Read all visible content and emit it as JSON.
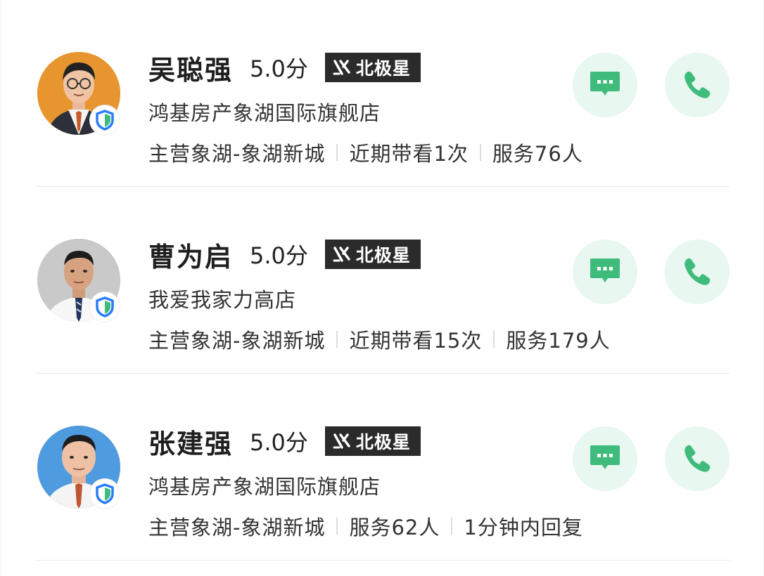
{
  "colors": {
    "accent_green": "#3fbb7b",
    "action_bg": "#e8f7ef",
    "brand_badge_bg": "#2b2b2b",
    "verified_blue": "#2a7df5"
  },
  "agents": [
    {
      "name": "吴聪强",
      "score": "5.0分",
      "brand_badge": "北极星",
      "shop": "鸿基房产象湖国际旗舰店",
      "meta": [
        "主营象湖-象湖新城",
        "近期带看1次",
        "服务76人"
      ],
      "icons": {
        "verified": "verified-shield-icon",
        "chat": "chat-bubble-icon",
        "call": "phone-icon"
      }
    },
    {
      "name": "曹为启",
      "score": "5.0分",
      "brand_badge": "北极星",
      "shop": "我爱我家力高店",
      "meta": [
        "主营象湖-象湖新城",
        "近期带看15次",
        "服务179人"
      ],
      "icons": {
        "verified": "verified-shield-icon",
        "chat": "chat-bubble-icon",
        "call": "phone-icon"
      }
    },
    {
      "name": "张建强",
      "score": "5.0分",
      "brand_badge": "北极星",
      "shop": "鸿基房产象湖国际旗舰店",
      "meta": [
        "主营象湖-象湖新城",
        "服务62人",
        "1分钟内回复"
      ],
      "icons": {
        "verified": "verified-shield-icon",
        "chat": "chat-bubble-icon",
        "call": "phone-icon"
      }
    }
  ]
}
